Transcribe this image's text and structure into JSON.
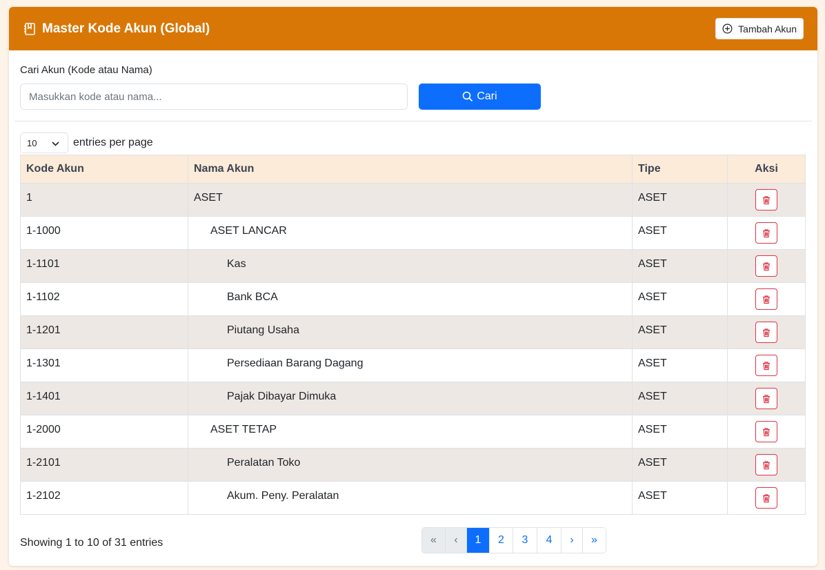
{
  "header": {
    "title": "Master Kode Akun (Global)",
    "add_button_label": "Tambah Akun"
  },
  "search": {
    "label": "Cari Akun (Kode atau Nama)",
    "placeholder": "Masukkan kode atau nama...",
    "value": "",
    "button_label": "Cari"
  },
  "entries": {
    "selected": "10",
    "label": "entries per page"
  },
  "table": {
    "columns": [
      "Kode Akun",
      "Nama Akun",
      "Tipe",
      "Aksi"
    ],
    "rows": [
      {
        "kode": "1",
        "nama": "ASET",
        "level": 1,
        "tipe": "ASET"
      },
      {
        "kode": "1-1000",
        "nama": "ASET LANCAR",
        "level": 2,
        "tipe": "ASET"
      },
      {
        "kode": "1-1101",
        "nama": "Kas",
        "level": 3,
        "tipe": "ASET"
      },
      {
        "kode": "1-1102",
        "nama": "Bank BCA",
        "level": 3,
        "tipe": "ASET"
      },
      {
        "kode": "1-1201",
        "nama": "Piutang Usaha",
        "level": 3,
        "tipe": "ASET"
      },
      {
        "kode": "1-1301",
        "nama": "Persediaan Barang Dagang",
        "level": 3,
        "tipe": "ASET"
      },
      {
        "kode": "1-1401",
        "nama": "Pajak Dibayar Dimuka",
        "level": 3,
        "tipe": "ASET"
      },
      {
        "kode": "1-2000",
        "nama": "ASET TETAP",
        "level": 2,
        "tipe": "ASET"
      },
      {
        "kode": "1-2101",
        "nama": "Peralatan Toko",
        "level": 3,
        "tipe": "ASET"
      },
      {
        "kode": "1-2102",
        "nama": "Akum. Peny. Peralatan",
        "level": 3,
        "tipe": "ASET"
      }
    ]
  },
  "footer": {
    "showing": "Showing 1 to 10 of 31 entries"
  },
  "pagination": [
    {
      "label": "«",
      "state": "disabled"
    },
    {
      "label": "‹",
      "state": "disabled"
    },
    {
      "label": "1",
      "state": "active"
    },
    {
      "label": "2",
      "state": "normal"
    },
    {
      "label": "3",
      "state": "normal"
    },
    {
      "label": "4",
      "state": "normal"
    },
    {
      "label": "›",
      "state": "normal"
    },
    {
      "label": "»",
      "state": "normal"
    }
  ],
  "colors": {
    "header": "#d97706",
    "primary": "#0d6efd",
    "danger": "#dc3545",
    "row_stripe": "#ede8e3",
    "thead": "#fcebd9"
  }
}
